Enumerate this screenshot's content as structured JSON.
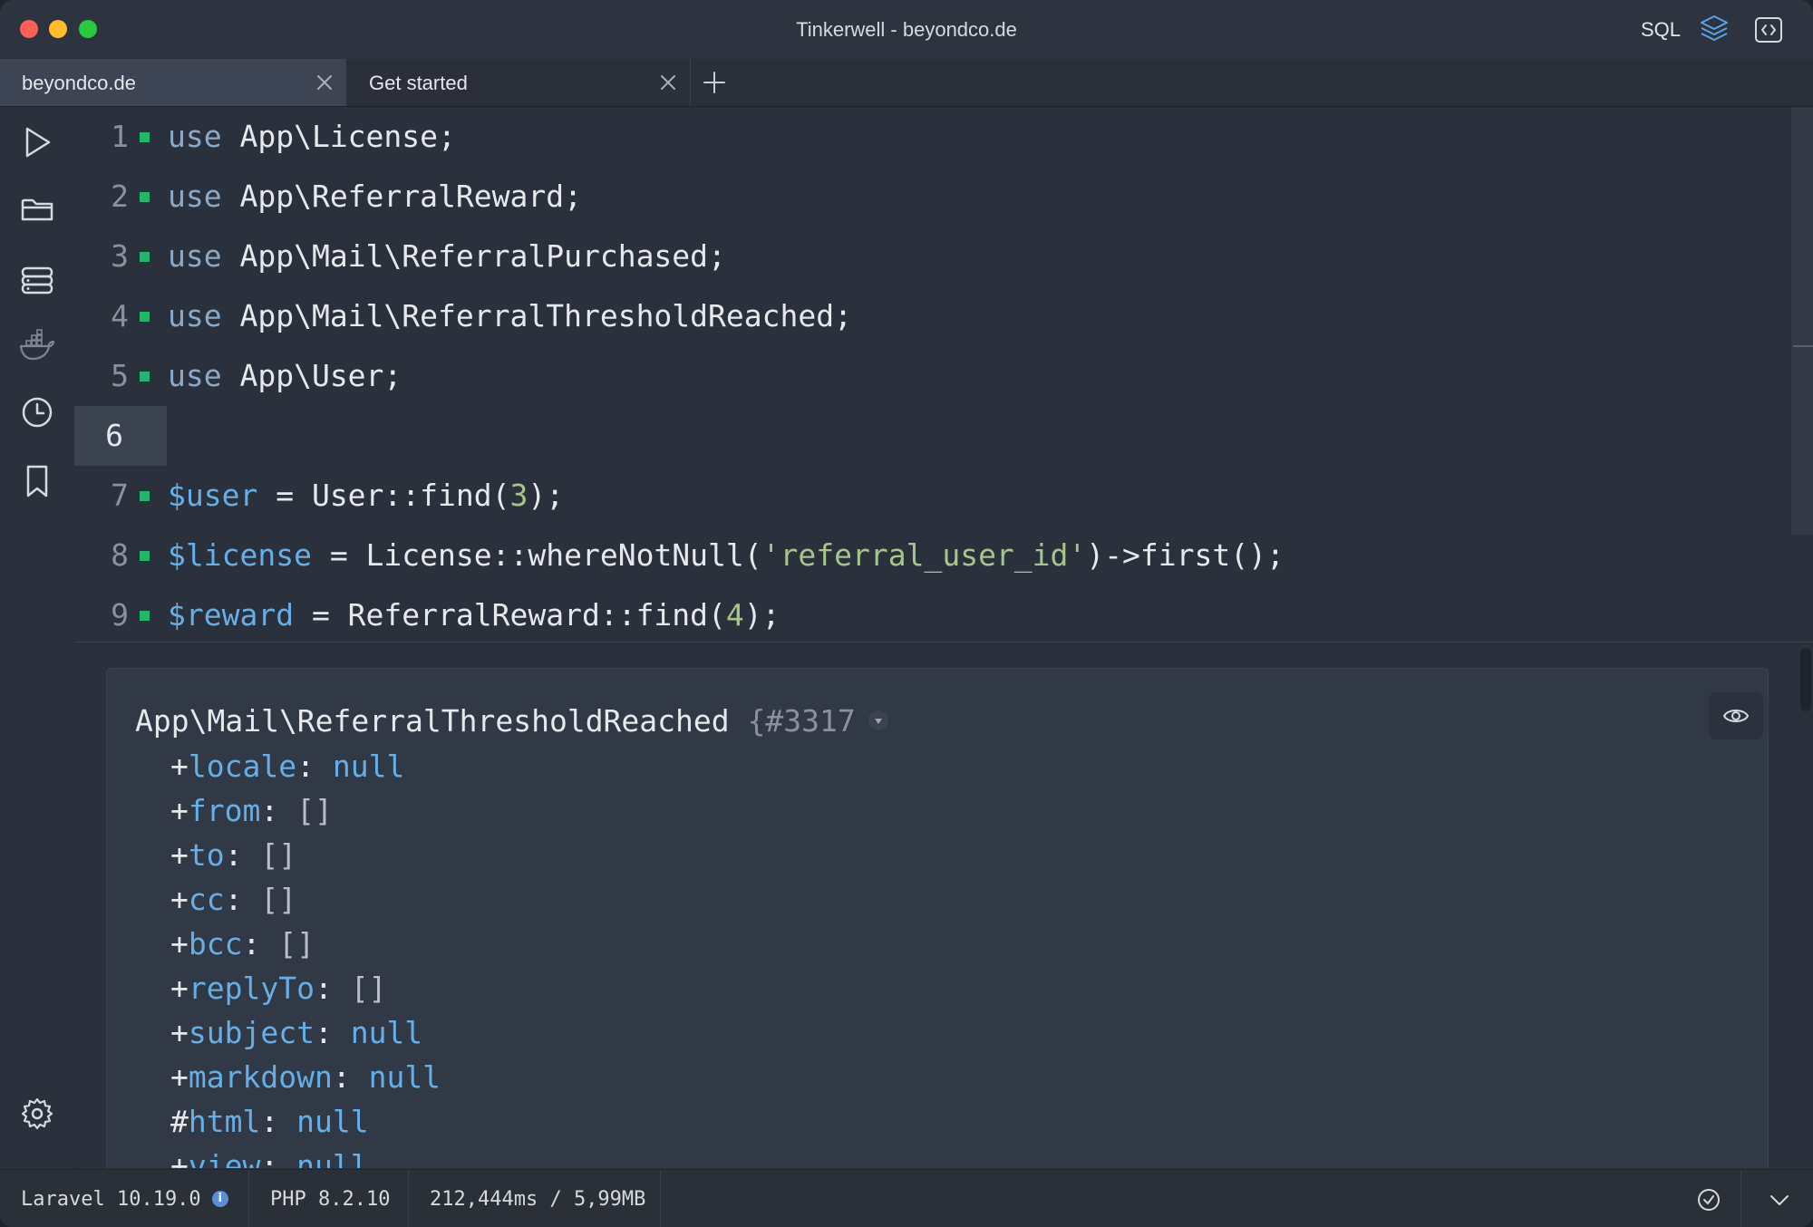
{
  "window": {
    "title": "Tinkerwell - beyondco.de"
  },
  "titlebar": {
    "sql_label": "SQL"
  },
  "tabs": [
    {
      "label": "beyondco.de",
      "active": true
    },
    {
      "label": "Get started",
      "active": false
    }
  ],
  "sidebar": {
    "items": [
      "run-icon",
      "folder-icon",
      "database-icon",
      "docker-icon",
      "history-icon",
      "bookmark-icon"
    ],
    "bottom": "settings-icon"
  },
  "editor": {
    "current_line": "6",
    "lines": [
      {
        "n": "1",
        "kw": "use",
        "rest": " App\\License;"
      },
      {
        "n": "2",
        "kw": "use",
        "rest": " App\\ReferralReward;"
      },
      {
        "n": "3",
        "kw": "use",
        "rest": " App\\Mail\\ReferralPurchased;"
      },
      {
        "n": "4",
        "kw": "use",
        "rest": " App\\Mail\\ReferralThresholdReached;"
      },
      {
        "n": "5",
        "kw": "use",
        "rest": " App\\User;"
      },
      {
        "n": "6"
      },
      {
        "n": "7",
        "var": "$user",
        "a": " = User::find(",
        "lit": "3",
        "b": ");"
      },
      {
        "n": "8",
        "var": "$license",
        "a": " = License::whereNotNull(",
        "lit": "'referral_user_id'",
        "b": ")->first();"
      },
      {
        "n": "9",
        "var": "$reward",
        "a": " = ReferralReward::find(",
        "lit": "4",
        "b": ");"
      }
    ]
  },
  "output": {
    "class_name": "App\\Mail\\ReferralThresholdReached",
    "brace": " {",
    "object_id": "#3317",
    "props": [
      {
        "vis": "+",
        "name": "locale",
        "value": "null"
      },
      {
        "vis": "+",
        "name": "from",
        "value": "[]"
      },
      {
        "vis": "+",
        "name": "to",
        "value": "[]"
      },
      {
        "vis": "+",
        "name": "cc",
        "value": "[]"
      },
      {
        "vis": "+",
        "name": "bcc",
        "value": "[]"
      },
      {
        "vis": "+",
        "name": "replyTo",
        "value": "[]"
      },
      {
        "vis": "+",
        "name": "subject",
        "value": "null"
      },
      {
        "vis": "+",
        "name": "markdown",
        "value": "null"
      },
      {
        "vis": "#",
        "name": "html",
        "value": "null"
      },
      {
        "vis": "+",
        "name": "view",
        "value": "null"
      }
    ]
  },
  "status": {
    "laravel": "Laravel 10.19.0",
    "php": "PHP 8.2.10",
    "perf": "212,444ms / 5,99MB"
  }
}
